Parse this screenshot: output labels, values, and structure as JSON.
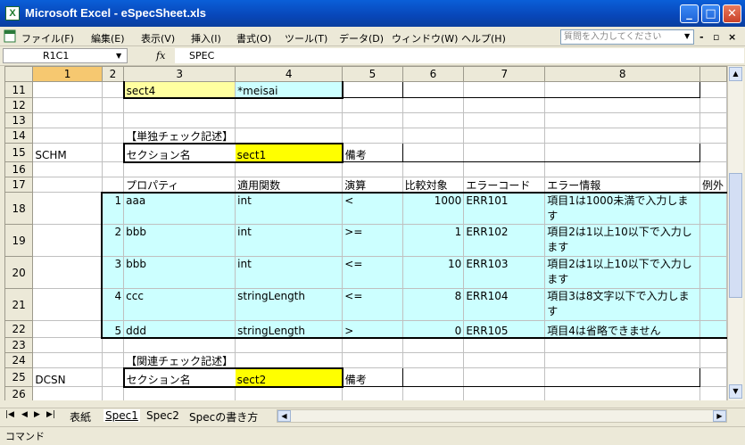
{
  "window": {
    "title": "Microsoft Excel - eSpecSheet.xls",
    "app_icon": "X",
    "minimize": "_",
    "maximize": "□",
    "close": "✕"
  },
  "menu": {
    "items": [
      "ファイル(F)",
      "編集(E)",
      "表示(V)",
      "挿入(I)",
      "書式(O)",
      "ツール(T)",
      "データ(D)",
      "ウィンドウ(W)",
      "ヘルプ(H)"
    ],
    "help_placeholder": "質問を入力してください"
  },
  "formula_bar": {
    "name_box": "R1C1",
    "fx": "fx",
    "content": "SPEC"
  },
  "columns": [
    "1",
    "2",
    "3",
    "4",
    "5",
    "6",
    "7",
    "8",
    ""
  ],
  "rows": {
    "r11": {
      "num": "11",
      "c3": "sect4",
      "c4": "*meisai"
    },
    "r12": {
      "num": "12"
    },
    "r13": {
      "num": "13"
    },
    "r14": {
      "num": "14",
      "c3": "【単独チェック記述】"
    },
    "r15": {
      "num": "15",
      "c1": "SCHM",
      "c3": "セクション名",
      "c4": "sect1",
      "c5": "備考"
    },
    "r16": {
      "num": "16"
    },
    "r17": {
      "num": "17",
      "c3": "プロパティ",
      "c4": "適用関数",
      "c5": "演算",
      "c6": "比較対象",
      "c7": "エラーコード",
      "c8": "エラー情報",
      "c9": "例外"
    },
    "r18": {
      "num": "18",
      "c2": "1",
      "c3": "aaa",
      "c4": "int",
      "c5": "<",
      "c6": "1000",
      "c7": "ERR101",
      "c8": "項目1は1000未満で入力します"
    },
    "r19": {
      "num": "19",
      "c2": "2",
      "c3": "bbb",
      "c4": "int",
      "c5": ">=",
      "c6": "1",
      "c7": "ERR102",
      "c8": "項目2は1以上10以下で入力します"
    },
    "r20": {
      "num": "20",
      "c2": "3",
      "c3": "bbb",
      "c4": "int",
      "c5": "<=",
      "c6": "10",
      "c7": "ERR103",
      "c8": "項目2は1以上10以下で入力します"
    },
    "r21": {
      "num": "21",
      "c2": "4",
      "c3": "ccc",
      "c4": "stringLength",
      "c5": "<=",
      "c6": "8",
      "c7": "ERR104",
      "c8": "項目3は8文字以下で入力します"
    },
    "r22": {
      "num": "22",
      "c2": "5",
      "c3": "ddd",
      "c4": "stringLength",
      "c5": ">",
      "c6": "0",
      "c7": "ERR105",
      "c8": "項目4は省略できません"
    },
    "r23": {
      "num": "23"
    },
    "r24": {
      "num": "24",
      "c3": "【関連チェック記述】"
    },
    "r25": {
      "num": "25",
      "c1": "DCSN",
      "c3": "セクション名",
      "c4": "sect2",
      "c5": "備考"
    },
    "r26": {
      "num": "26"
    }
  },
  "sheets": {
    "tabs": [
      "表紙",
      "Spec1",
      "Spec2",
      "Specの書き方"
    ],
    "active": "Spec1"
  },
  "status": "コマンド",
  "colors": {
    "yellow": "#ffff00",
    "light_yellow": "#ffffa0",
    "cyan": "#ccffff",
    "title_blue": "#0a5fd8"
  }
}
